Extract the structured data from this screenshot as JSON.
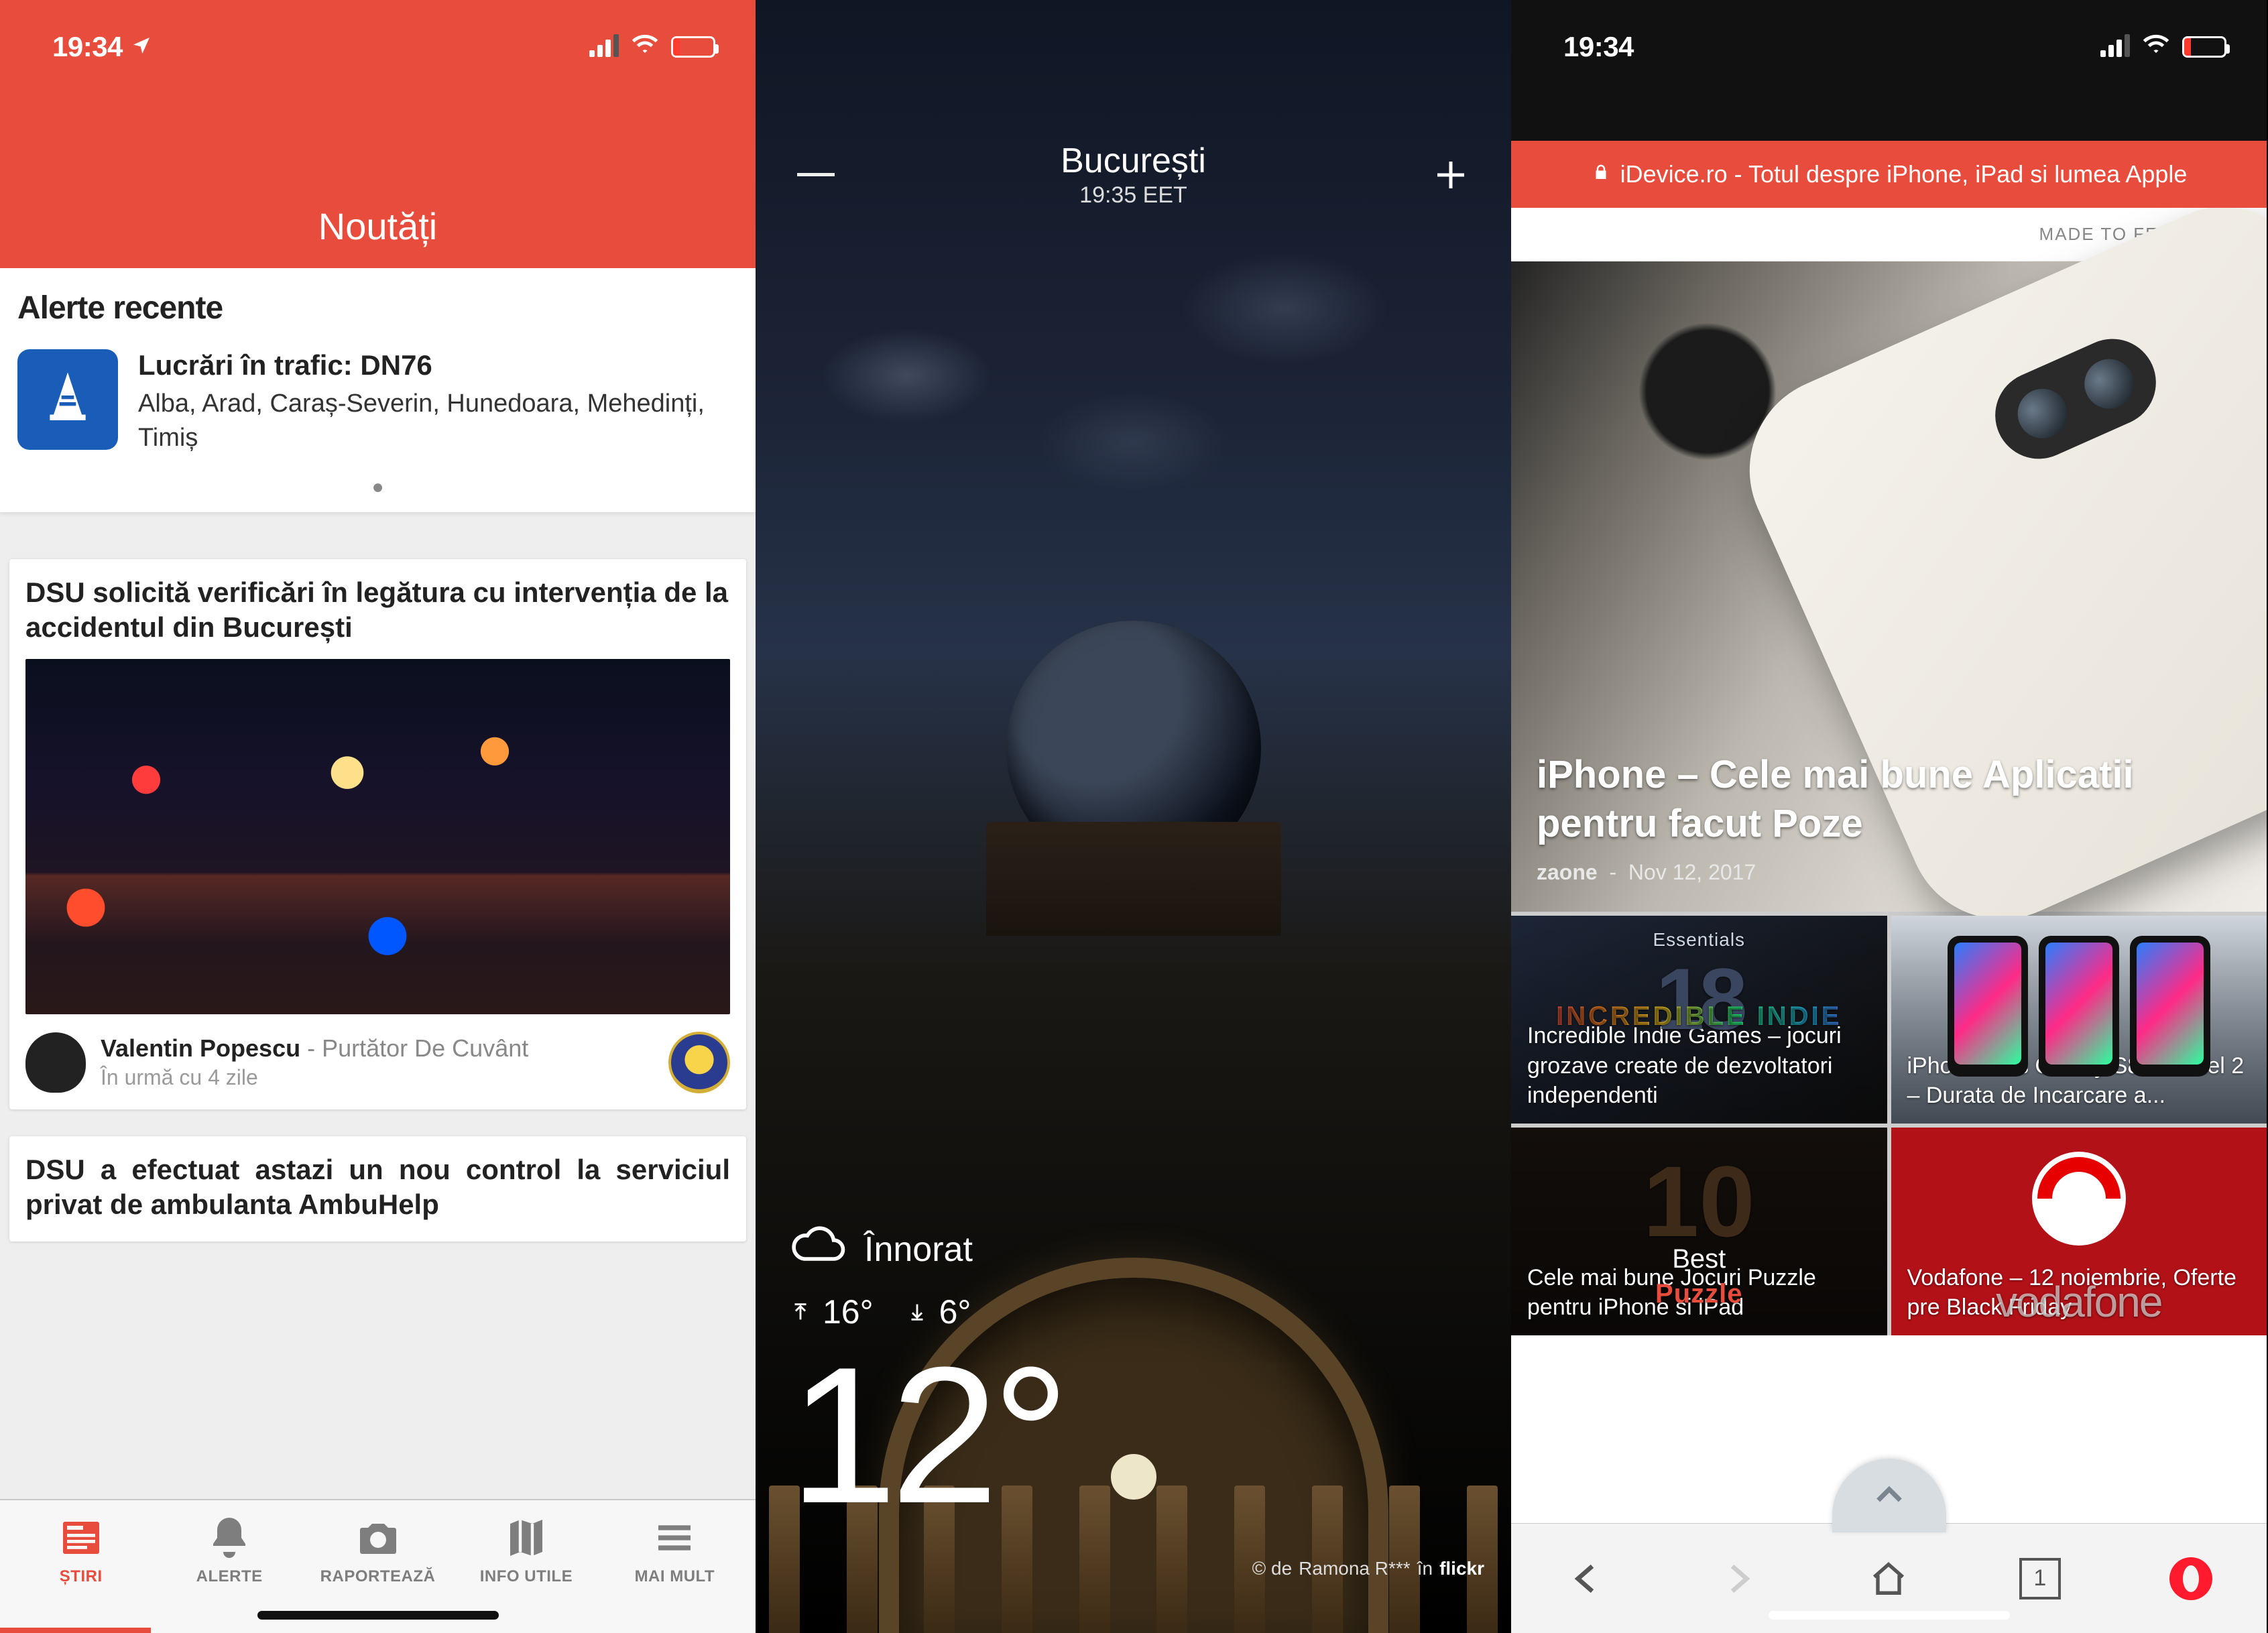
{
  "status": {
    "time": "19:34",
    "location_arrow": true,
    "battery_low": true
  },
  "screen1": {
    "header": "Noutăți",
    "alerts_heading": "Alerte recente",
    "alert": {
      "title": "Lucrări în trafic: DN76",
      "subtitle": "Alba, Arad, Caraș-Severin, Hunedoara, Mehedinți, Timiș",
      "icon": "traffic-cone-icon"
    },
    "news": [
      {
        "title": "DSU solicită verificări în legătura cu intervenția de la accidentul din București",
        "author": "Valentin Popescu",
        "role": "Purtător De Cuvânt",
        "time": "În urmă cu 4 zile"
      },
      {
        "title": "DSU a efectuat astazi un nou control la serviciul privat de ambulanta AmbuHelp"
      }
    ],
    "tabs": [
      {
        "label": "ȘTIRI",
        "icon": "news-icon",
        "active": true
      },
      {
        "label": "ALERTE",
        "icon": "bell-icon",
        "active": false
      },
      {
        "label": "RAPORTEAZĂ",
        "icon": "camera-icon",
        "active": false
      },
      {
        "label": "INFO UTILE",
        "icon": "map-icon",
        "active": false
      },
      {
        "label": "MAI MULT",
        "icon": "menu-icon",
        "active": false
      }
    ]
  },
  "screen2": {
    "city": "București",
    "local_time": "19:35 EET",
    "condition": "Înnorat",
    "high": "16°",
    "low": "6°",
    "temp": "12°",
    "credit_prefix": "© de ",
    "credit_author": "Ramona R***",
    "credit_in": " în ",
    "credit_site": "flickr"
  },
  "screen3": {
    "url_title": "iDevice.ro - Totul despre iPhone, iPad si lumea Apple",
    "banner": "MADE TO FEEL GOOD",
    "hero": {
      "title": "iPhone – Cele mai bune Aplicatii pentru facut Poze",
      "author": "zaone",
      "sep": "-",
      "date": "Nov 12, 2017"
    },
    "tiles": [
      {
        "title": "Incredible Indie Games – jocuri grozave create de dezvoltatori independenti",
        "tag_top": "Essentials",
        "tag_mid": "INCREDIBLE INDIE"
      },
      {
        "title": "iPhone X vs Galaxy S8 vs Pixel 2 – Durata de Incarcare a..."
      },
      {
        "title": "Cele mai bune Jocuri Puzzle pentru iPhone si iPad",
        "tag_word1": "Best",
        "tag_word2": "Puzzle"
      },
      {
        "title": "Vodafone – 12 noiembrie, Oferte pre Black Friday",
        "watermark": "vodafone"
      }
    ],
    "tab_count": "1"
  }
}
